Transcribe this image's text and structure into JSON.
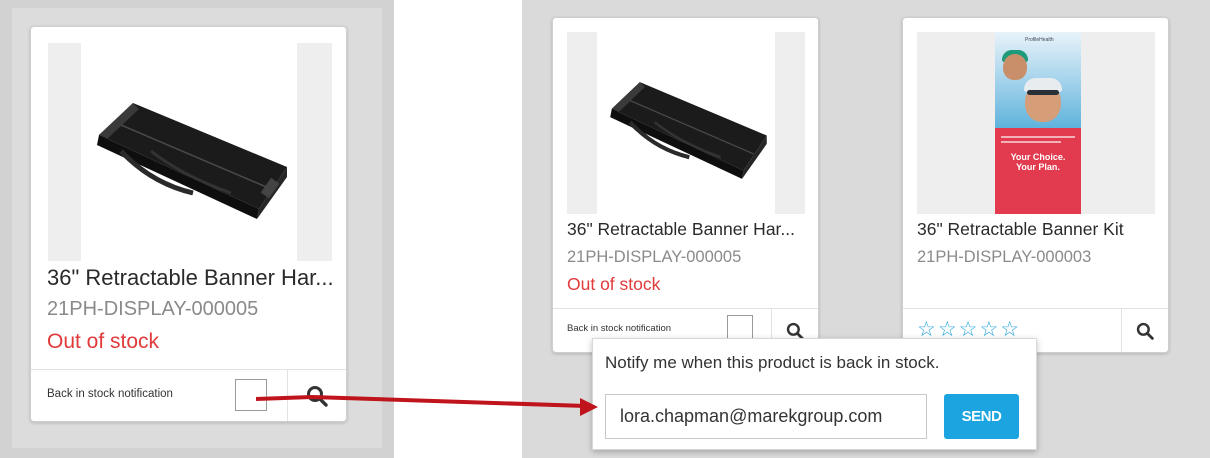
{
  "zoomed_card": {
    "title": "36\" Retractable Banner Har...",
    "sku": "21PH-DISPLAY-000005",
    "stock_status": "Out of stock",
    "notification_label": "Back in stock notification"
  },
  "products": [
    {
      "title": "36\" Retractable Banner Har...",
      "sku": "21PH-DISPLAY-000005",
      "stock_status": "Out of stock",
      "notification_label": "Back in stock notification",
      "image": "black-banner-case"
    },
    {
      "title": "36\" Retractable Banner Kit",
      "sku": "21PH-DISPLAY-000003",
      "rating_stars": "☆☆☆☆☆",
      "rating": 0,
      "rating_max": 5,
      "image": "banner-swimmers",
      "banner": {
        "logo_text": "ProfileHealth",
        "tagline": "Your Choice.\nYour Plan."
      }
    }
  ],
  "notify_popup": {
    "message": "Notify me when this product is back in stock.",
    "email_value": "lora.chapman@marekgroup.com",
    "send_label": "SEND"
  },
  "icons": {
    "search": "magnifier-icon",
    "star": "star-outline-icon",
    "annotation": "red-arrow"
  },
  "colors": {
    "accent": "#1ba4e0",
    "out_of_stock": "#e03a3a",
    "annotation_arrow": "#c0141c",
    "star": "#2aa7dd"
  }
}
